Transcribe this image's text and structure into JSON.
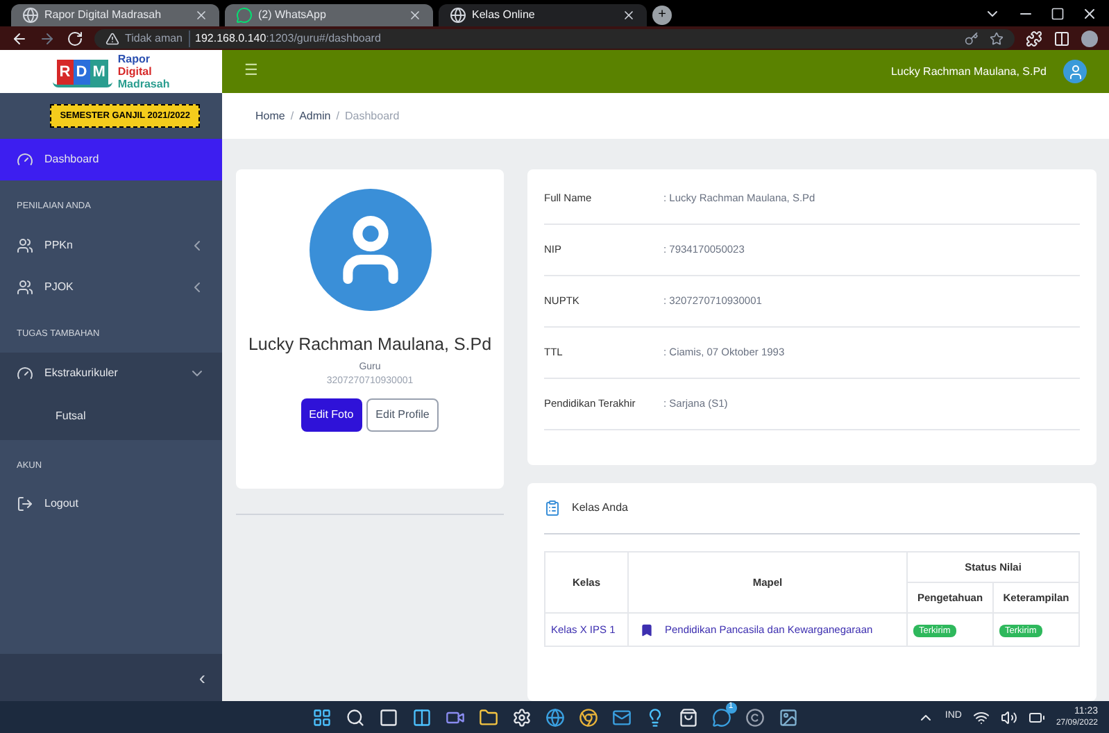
{
  "browser": {
    "tabs": [
      {
        "title": "Rapor Digital Madrasah",
        "selected": false
      },
      {
        "title": "(2) WhatsApp",
        "selected": false
      },
      {
        "title": "Kelas Online",
        "selected": true
      }
    ],
    "new_tab": "+",
    "url": {
      "warning": "Tidak aman",
      "host": "192.168.0.140",
      "path": ":1203/guru#/dashboard"
    }
  },
  "logo": {
    "letters": [
      "R",
      "D",
      "M"
    ],
    "lines": [
      "Rapor",
      "Digital",
      "Madrasah"
    ]
  },
  "header": {
    "menu": "☰",
    "user": "Lucky Rachman Maulana, S.Pd"
  },
  "semester": "SEMESTER GANJIL 2021/2022",
  "breadcrumb": [
    {
      "text": "Home",
      "kind": "link"
    },
    {
      "text": "/",
      "kind": "separator"
    },
    {
      "text": "Admin",
      "kind": "link"
    },
    {
      "text": "/",
      "kind": "separator"
    },
    {
      "text": "Dashboard",
      "kind": "current"
    }
  ],
  "sidebar": {
    "sections": [
      {
        "items": [
          {
            "label": "Dashboard",
            "kind": "link",
            "selected": true
          }
        ]
      },
      {
        "heading": "PENILAIAN ANDA",
        "items": [
          {
            "label": "PPKn",
            "kind": "menu",
            "selected": false,
            "expanded": false
          },
          {
            "label": "PJOK",
            "kind": "menu",
            "selected": false,
            "expanded": false
          }
        ]
      },
      {
        "heading": "TUGAS TAMBAHAN",
        "items": [
          {
            "label": "Ekstrakurikuler",
            "kind": "menu",
            "selected": false,
            "expanded": true,
            "children": [
              {
                "label": "Futsal",
                "selected": false
              }
            ]
          }
        ]
      },
      {
        "heading": "AKUN",
        "items": [
          {
            "label": "Logout",
            "kind": "link",
            "selected": false
          }
        ]
      }
    ],
    "collapse": "‹"
  },
  "profile": {
    "name": "Lucky Rachman Maulana, S.Pd",
    "role": "Guru",
    "id": "3207270710930001",
    "buttons": [
      {
        "label": "Edit Foto",
        "kind": "primary"
      },
      {
        "label": "Edit Profile",
        "kind": "outline"
      }
    ]
  },
  "info": [
    {
      "label": "Full Name",
      "value": ": Lucky Rachman Maulana, S.Pd"
    },
    {
      "label": "NIP",
      "value": ": 7934170050023"
    },
    {
      "label": "NUPTK",
      "value": ": 3207270710930001"
    },
    {
      "label": "TTL",
      "value": ": Ciamis, 07 Oktober 1993"
    },
    {
      "label": "Pendidikan Terakhir",
      "value": ": Sarjana (S1)"
    }
  ],
  "kelas": {
    "title": "Kelas Anda",
    "columns": {
      "kelas": "Kelas",
      "mapel": "Mapel",
      "status": "Status Nilai",
      "pengetahuan": "Pengetahuan",
      "keterampilan": "Keterampilan"
    },
    "rows": [
      {
        "kelas": "Kelas X IPS 1",
        "mapel": "Pendidikan Pancasila dan Kewarganegaraan",
        "pengetahuan": "Terkirim",
        "keterampilan": "Terkirim"
      }
    ]
  },
  "taskbar": {
    "language": "IND",
    "time": "11:23",
    "date": "27/09/2022",
    "badge": "1"
  }
}
